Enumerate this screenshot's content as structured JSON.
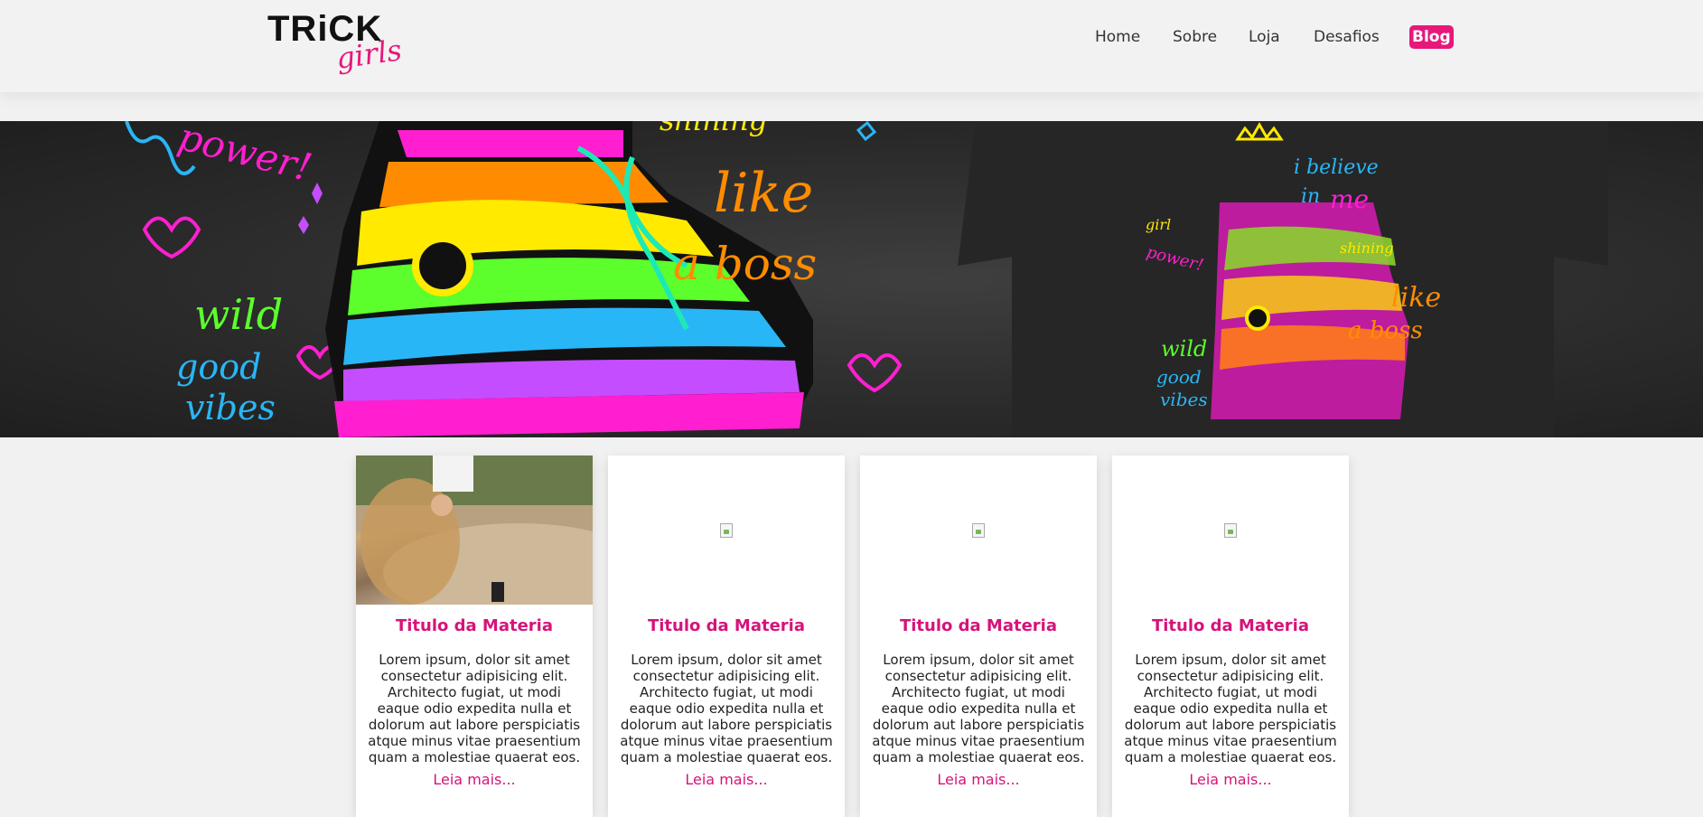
{
  "header": {
    "logo": {
      "primary": "TRiCK",
      "secondary": "girls"
    },
    "nav": [
      {
        "label": "Home",
        "active": false
      },
      {
        "label": "Sobre",
        "active": false
      },
      {
        "label": "Loja",
        "active": false
      },
      {
        "label": "Desafios",
        "active": false
      },
      {
        "label": "Blog",
        "active": true
      }
    ]
  },
  "hero": {
    "texts": [
      "power!",
      "shining",
      "like",
      "a boss",
      "wild",
      "good",
      "vibes",
      "i believe",
      "in",
      "me",
      "girl",
      "power!",
      "shining",
      "like",
      "a boss",
      "wild",
      "good",
      "vibes"
    ]
  },
  "cards": [
    {
      "title": "Titulo da Materia",
      "text": "Lorem ipsum, dolor sit amet consectetur adipisicing elit. Architecto fugiat, ut modi eaque odio expedita nulla et dolorum aut labore perspiciatis atque minus vitae praesentium quam a molestiae quaerat eos.",
      "link": "Leia mais...",
      "has_image": true
    },
    {
      "title": "Titulo da Materia",
      "text": "Lorem ipsum, dolor sit amet consectetur adipisicing elit. Architecto fugiat, ut modi eaque odio expedita nulla et dolorum aut labore perspiciatis atque minus vitae praesentium quam a molestiae quaerat eos.",
      "link": "Leia mais...",
      "has_image": false
    },
    {
      "title": "Titulo da Materia",
      "text": "Lorem ipsum, dolor sit amet consectetur adipisicing elit. Architecto fugiat, ut modi eaque odio expedita nulla et dolorum aut labore perspiciatis atque minus vitae praesentium quam a molestiae quaerat eos.",
      "link": "Leia mais...",
      "has_image": false
    },
    {
      "title": "Titulo da Materia",
      "text": "Lorem ipsum, dolor sit amet consectetur adipisicing elit. Architecto fugiat, ut modi eaque odio expedita nulla et dolorum aut labore perspiciatis atque minus vitae praesentium quam a molestiae quaerat eos.",
      "link": "Leia mais...",
      "has_image": false
    }
  ],
  "colors": {
    "accent": "#e8177a",
    "background": "#f1f1f1"
  }
}
